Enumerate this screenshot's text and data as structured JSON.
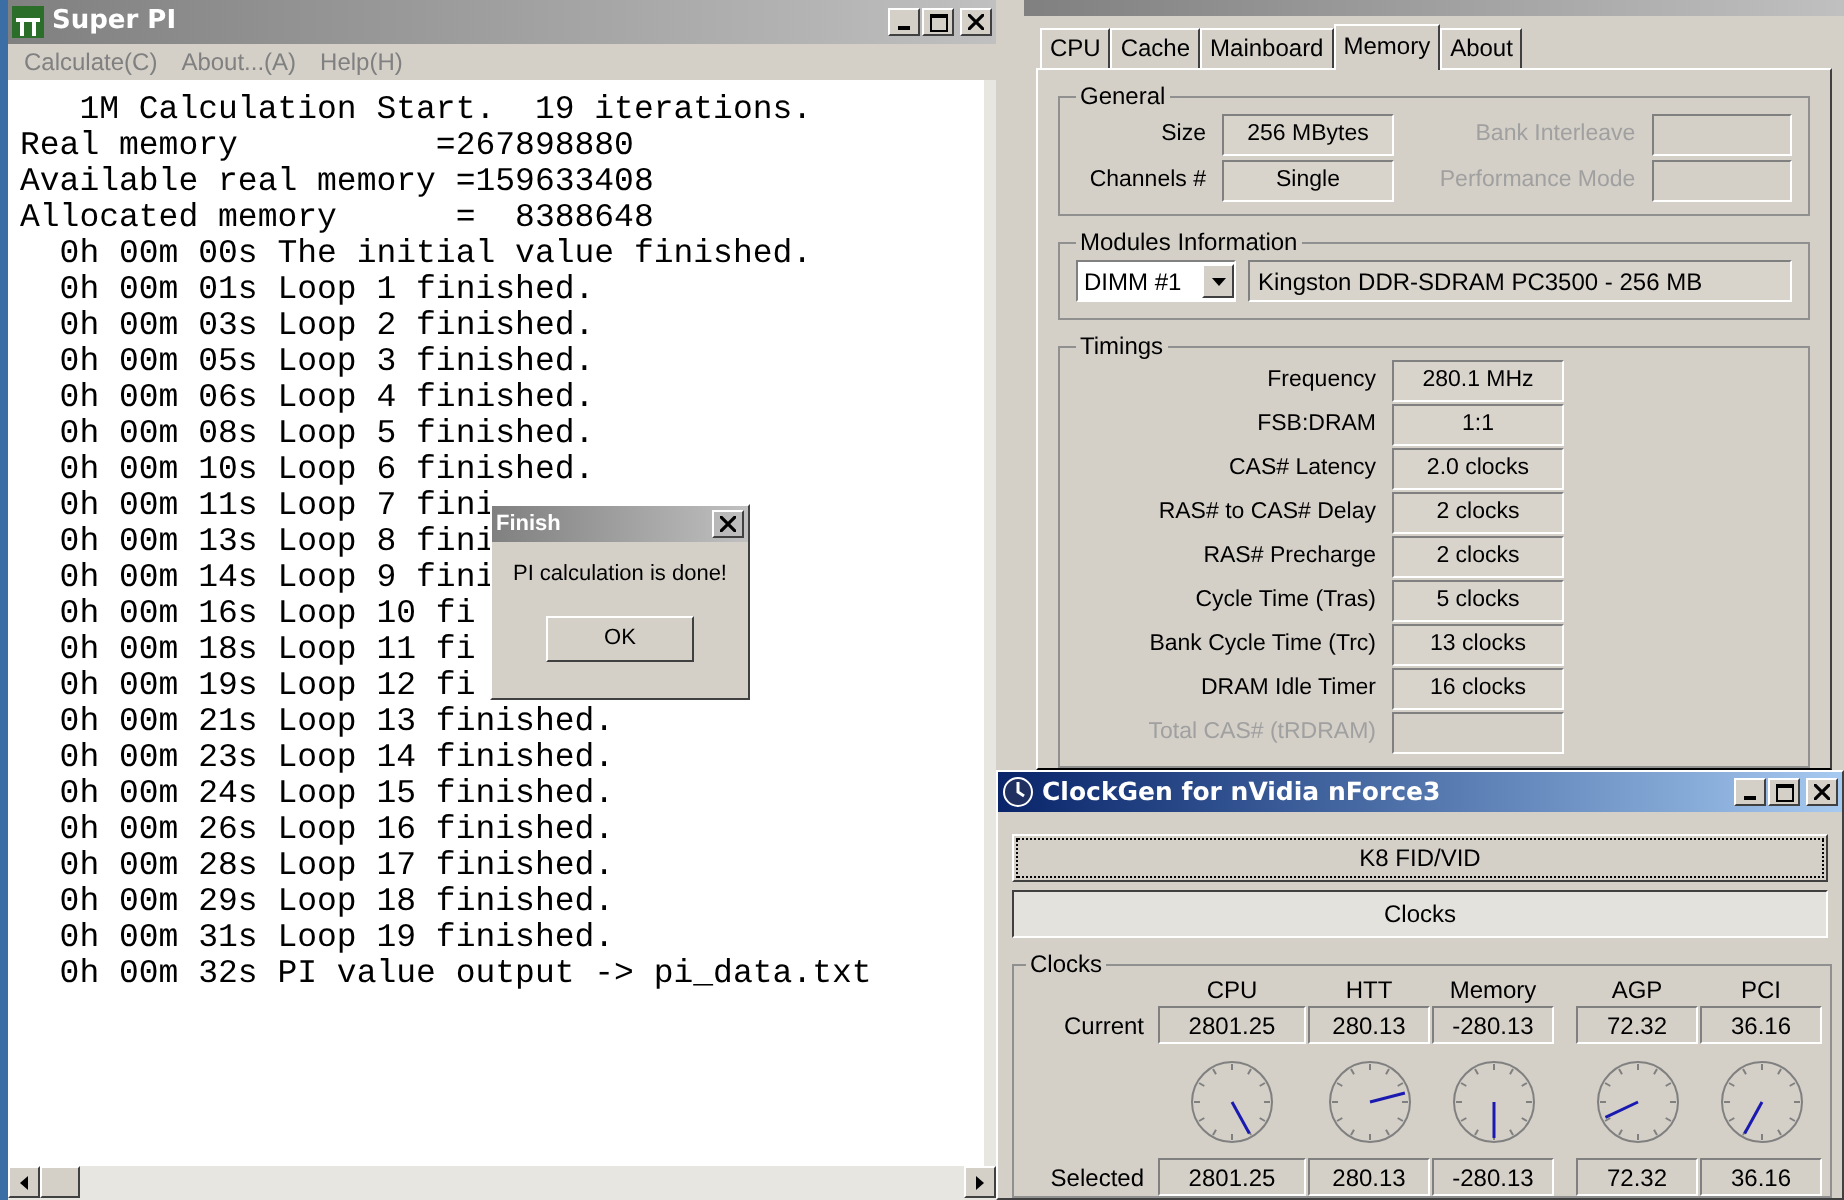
{
  "superpi": {
    "title": "Super PI",
    "menu": [
      "Calculate(C)",
      "About...(A)",
      "Help(H)"
    ],
    "lines": [
      "   1M Calculation Start.  19 iterations.",
      "Real memory          =267898880",
      "Available real memory =159633408",
      "Allocated memory      =  8388648",
      "  0h 00m 00s The initial value finished.",
      "  0h 00m 01s Loop 1 finished.",
      "  0h 00m 03s Loop 2 finished.",
      "  0h 00m 05s Loop 3 finished.",
      "  0h 00m 06s Loop 4 finished.",
      "  0h 00m 08s Loop 5 finished.",
      "  0h 00m 10s Loop 6 finished.",
      "  0h 00m 11s Loop 7 fini",
      "  0h 00m 13s Loop 8 fini",
      "  0h 00m 14s Loop 9 fini",
      "  0h 00m 16s Loop 10 fi",
      "  0h 00m 18s Loop 11 fi",
      "  0h 00m 19s Loop 12 fi",
      "  0h 00m 21s Loop 13 finished.",
      "  0h 00m 23s Loop 14 finished.",
      "  0h 00m 24s Loop 15 finished.",
      "  0h 00m 26s Loop 16 finished.",
      "  0h 00m 28s Loop 17 finished.",
      "  0h 00m 29s Loop 18 finished.",
      "  0h 00m 31s Loop 19 finished.",
      "  0h 00m 32s PI value output -> pi_data.txt"
    ],
    "dialog": {
      "title": "Finish",
      "message": "PI calculation is done!",
      "button": "OK"
    }
  },
  "cpuz": {
    "tabs": [
      {
        "label": "CPU",
        "selected": false
      },
      {
        "label": "Cache",
        "selected": false
      },
      {
        "label": "Mainboard",
        "selected": false
      },
      {
        "label": "Memory",
        "selected": true
      },
      {
        "label": "About",
        "selected": false
      }
    ],
    "general": {
      "title": "General",
      "fields": [
        {
          "label": "Size",
          "value": "256 MBytes",
          "disabled": false
        },
        {
          "label": "Bank Interleave",
          "disabled": true
        },
        {
          "label": "Channels #",
          "value": "Single",
          "disabled": false
        },
        {
          "label": "Performance Mode",
          "disabled": true
        }
      ]
    },
    "modules": {
      "title": "Modules Information",
      "slot": "DIMM #1",
      "description": "Kingston DDR-SDRAM PC3500 - 256 MB"
    },
    "timings": {
      "title": "Timings",
      "fields": [
        {
          "label": "Frequency",
          "value": "280.1 MHz",
          "disabled": false
        },
        {
          "label": "FSB:DRAM",
          "value": "1:1",
          "disabled": false
        },
        {
          "label": "CAS# Latency",
          "value": "2.0 clocks",
          "disabled": false
        },
        {
          "label": "RAS# to CAS# Delay",
          "value": "2 clocks",
          "disabled": false
        },
        {
          "label": "RAS# Precharge",
          "value": "2 clocks",
          "disabled": false
        },
        {
          "label": "Cycle Time (Tras)",
          "value": "5 clocks",
          "disabled": false
        },
        {
          "label": "Bank Cycle Time (Trc)",
          "value": "13 clocks",
          "disabled": false
        },
        {
          "label": "DRAM Idle Timer",
          "value": "16 clocks",
          "disabled": false
        },
        {
          "label": "Total CAS# (tRDRAM)",
          "disabled": true
        }
      ]
    }
  },
  "clockgen": {
    "title": "ClockGen for nVidia nForce3",
    "buttons": [
      {
        "label": "K8 FID/VID",
        "selected": false
      },
      {
        "label": "Clocks",
        "selected": true
      }
    ],
    "clocks": {
      "title": "Clocks",
      "row_labels": [
        "Current",
        "Selected"
      ],
      "columns": [
        {
          "name": "CPU",
          "current": "2801.25",
          "selected": "2801.25"
        },
        {
          "name": "HTT",
          "current": "280.13",
          "selected": "280.13"
        },
        {
          "name": "Memory",
          "current": "-280.13",
          "selected": "-280.13"
        },
        {
          "name": "AGP",
          "current": "72.32",
          "selected": "72.32"
        },
        {
          "name": "PCI",
          "current": "36.16",
          "selected": "36.16"
        }
      ]
    }
  }
}
